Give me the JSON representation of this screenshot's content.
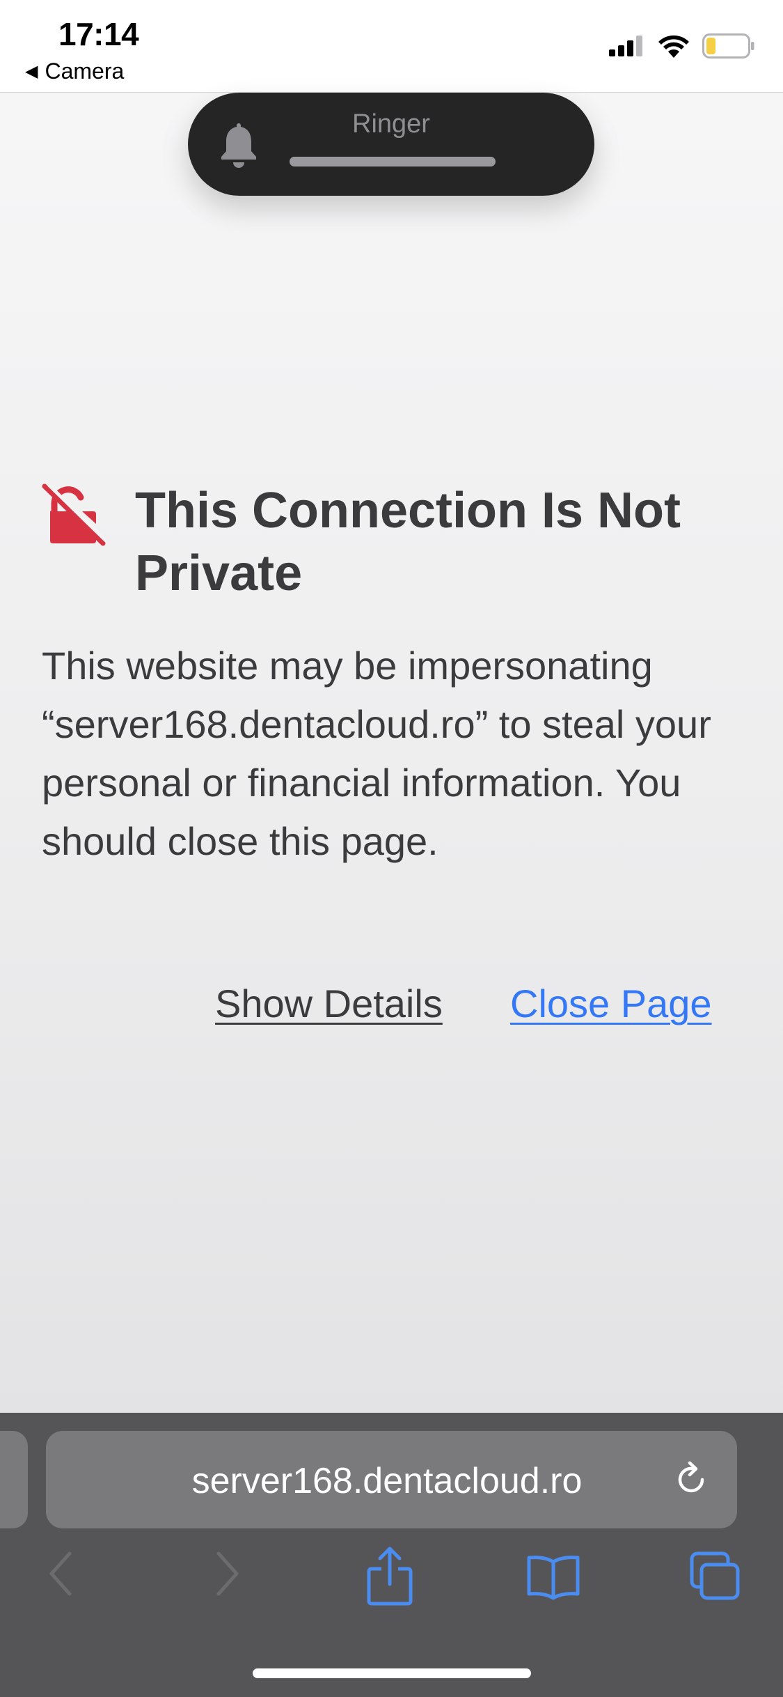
{
  "status_bar": {
    "time": "17:14",
    "back_app": "Camera",
    "back_icon": "back-triangle-icon",
    "signal_icon": "cellular-signal-icon",
    "wifi_icon": "wifi-icon",
    "battery_icon": "battery-icon",
    "battery_color": "#f5d046"
  },
  "ringer": {
    "label": "Ringer",
    "icon": "bell-icon"
  },
  "warning": {
    "icon": "lock-slash-icon",
    "icon_color": "#d63242",
    "title": "This Connection Is Not Private",
    "body": "This website may be impersonating “server168.dentacloud.ro” to steal your personal or financial information. You should close this page.",
    "show_details": "Show Details",
    "close_page": "Close Page",
    "link_color": "#3478f6"
  },
  "toolbar": {
    "url": "server168.dentacloud.ro",
    "reload_icon": "reload-icon",
    "back_icon": "chevron-left-icon",
    "forward_icon": "chevron-right-icon",
    "share_icon": "share-icon",
    "bookmarks_icon": "book-icon",
    "tabs_icon": "tabs-icon",
    "accent": "#4a8cf0"
  }
}
